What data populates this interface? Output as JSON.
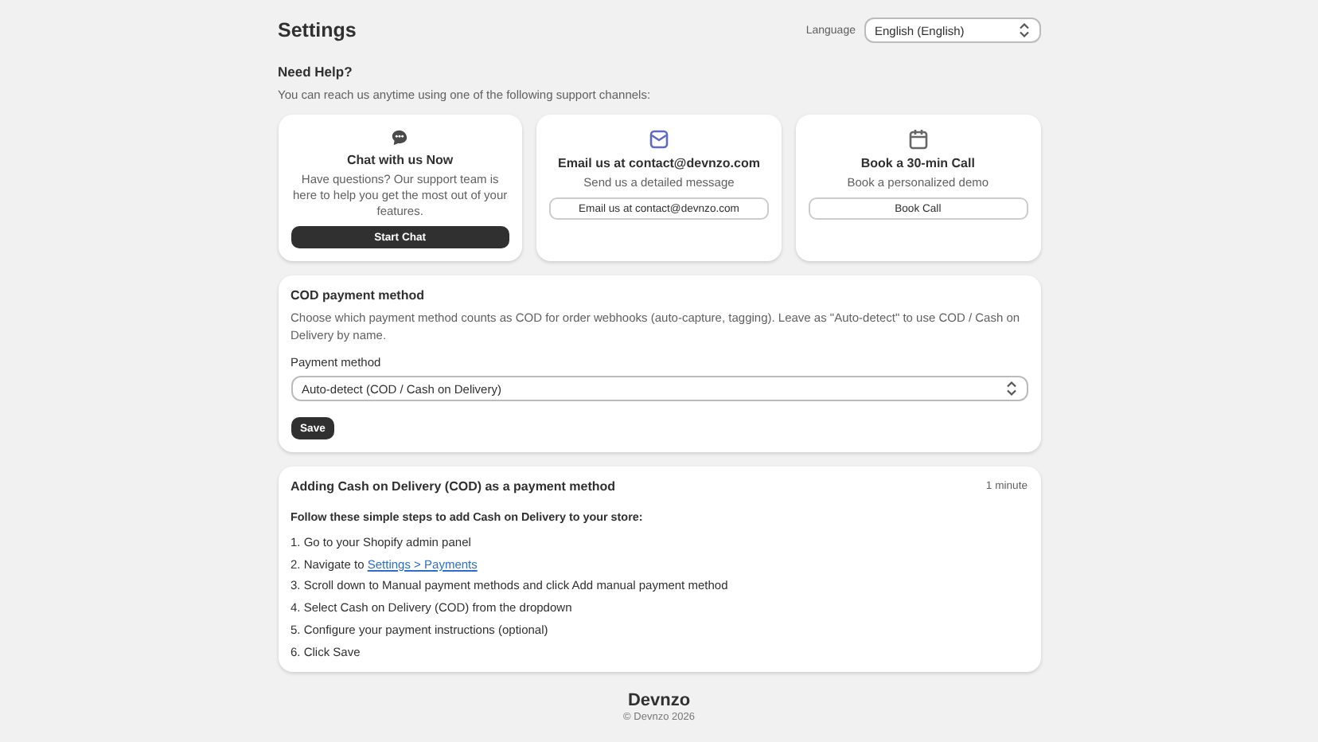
{
  "header": {
    "title": "Settings",
    "language_label": "Language",
    "language_value": "English (English)"
  },
  "help": {
    "title": "Need Help?",
    "description": "You can reach us anytime using one of the following support channels:",
    "cards": [
      {
        "kind": "chat",
        "title": "Chat with us Now",
        "text": "Have questions? Our support team is here to help you get the most out of your features.",
        "button": {
          "label": "Start Chat",
          "kind": "primary"
        }
      },
      {
        "kind": "email",
        "title": "Email us at contact@devnzo.com",
        "text": "Send us a detailed message",
        "button": {
          "label": "Email us at contact@devnzo.com",
          "kind": "secondary"
        }
      },
      {
        "kind": "calendar",
        "title": "Book a 30-min Call",
        "text": "Book a personalized demo",
        "button": {
          "label": "Book Call",
          "kind": "secondary"
        }
      }
    ]
  },
  "cod": {
    "title": "COD payment method",
    "description": "Choose which payment method counts as COD for order webhooks (auto-capture, tagging). Leave as \"Auto-detect\" to use COD / Cash on Delivery by name.",
    "field_label": "Payment method",
    "field_value": "Auto-detect (COD / Cash on Delivery)",
    "button": "Save"
  },
  "guide": {
    "title": "Adding Cash on Delivery (COD) as a payment method",
    "duration": "1 minute",
    "intro": "Follow these simple steps to add Cash on Delivery to your store:",
    "steps": [
      {
        "text": "1. Go to your Shopify admin panel"
      },
      {
        "text": "2. Navigate to ",
        "link": "Settings > Payments"
      },
      {
        "text": "3. Scroll down to Manual payment methods and click Add manual payment method"
      },
      {
        "text": "4. Select Cash on Delivery (COD) from the dropdown"
      },
      {
        "text": "5. Configure your payment instructions (optional)"
      },
      {
        "text": "6. Click Save"
      }
    ]
  },
  "footer": {
    "brand": "Devnzo",
    "copyright": "© Devnzo 2026"
  }
}
